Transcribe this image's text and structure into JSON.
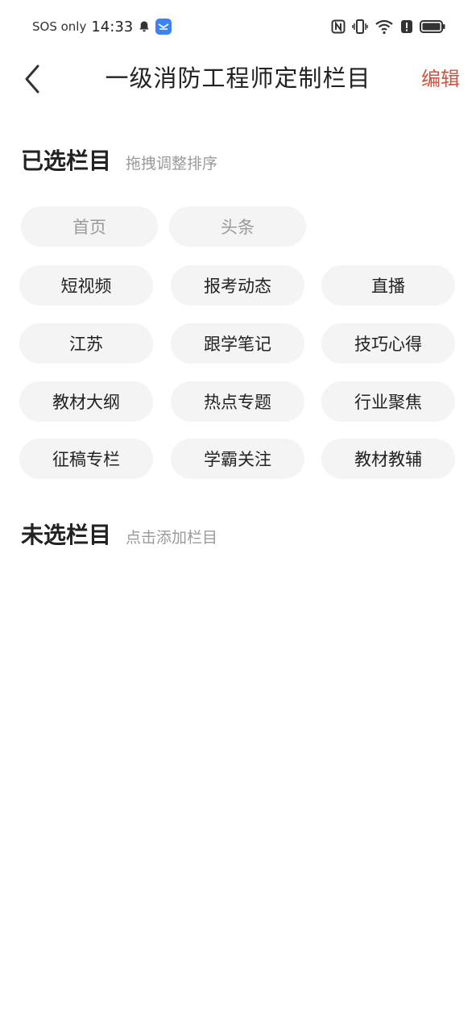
{
  "status_bar": {
    "carrier": "SOS only",
    "time": "14:33"
  },
  "header": {
    "title": "一级消防工程师定制栏目",
    "edit_label": "编辑"
  },
  "selected": {
    "title": "已选栏目",
    "hint": "拖拽调整排序",
    "fixed": [
      "首页",
      "头条"
    ],
    "items": [
      "短视频",
      "报考动态",
      "直播",
      "江苏",
      "跟学笔记",
      "技巧心得",
      "教材大纲",
      "热点专题",
      "行业聚焦",
      "征稿专栏",
      "学霸关注",
      "教材教辅"
    ]
  },
  "unselected": {
    "title": "未选栏目",
    "hint": "点击添加栏目"
  },
  "colors": {
    "accent": "#d0533c",
    "chip_bg": "#f4f4f4",
    "hint": "#9a9a9a"
  }
}
